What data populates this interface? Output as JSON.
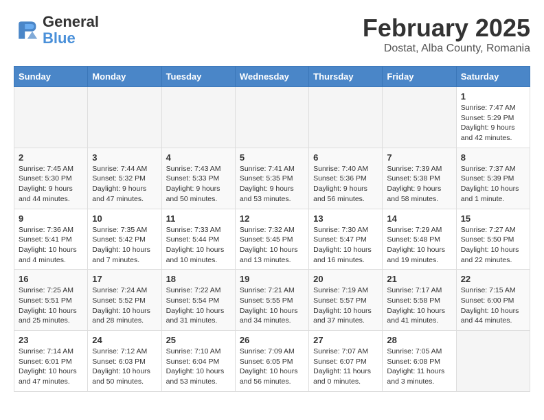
{
  "logo": {
    "text_general": "General",
    "text_blue": "Blue"
  },
  "title": "February 2025",
  "subtitle": "Dostat, Alba County, Romania",
  "weekdays": [
    "Sunday",
    "Monday",
    "Tuesday",
    "Wednesday",
    "Thursday",
    "Friday",
    "Saturday"
  ],
  "weeks": [
    [
      {
        "day": "",
        "info": ""
      },
      {
        "day": "",
        "info": ""
      },
      {
        "day": "",
        "info": ""
      },
      {
        "day": "",
        "info": ""
      },
      {
        "day": "",
        "info": ""
      },
      {
        "day": "",
        "info": ""
      },
      {
        "day": "1",
        "info": "Sunrise: 7:47 AM\nSunset: 5:29 PM\nDaylight: 9 hours and 42 minutes."
      }
    ],
    [
      {
        "day": "2",
        "info": "Sunrise: 7:45 AM\nSunset: 5:30 PM\nDaylight: 9 hours and 44 minutes."
      },
      {
        "day": "3",
        "info": "Sunrise: 7:44 AM\nSunset: 5:32 PM\nDaylight: 9 hours and 47 minutes."
      },
      {
        "day": "4",
        "info": "Sunrise: 7:43 AM\nSunset: 5:33 PM\nDaylight: 9 hours and 50 minutes."
      },
      {
        "day": "5",
        "info": "Sunrise: 7:41 AM\nSunset: 5:35 PM\nDaylight: 9 hours and 53 minutes."
      },
      {
        "day": "6",
        "info": "Sunrise: 7:40 AM\nSunset: 5:36 PM\nDaylight: 9 hours and 56 minutes."
      },
      {
        "day": "7",
        "info": "Sunrise: 7:39 AM\nSunset: 5:38 PM\nDaylight: 9 hours and 58 minutes."
      },
      {
        "day": "8",
        "info": "Sunrise: 7:37 AM\nSunset: 5:39 PM\nDaylight: 10 hours and 1 minute."
      }
    ],
    [
      {
        "day": "9",
        "info": "Sunrise: 7:36 AM\nSunset: 5:41 PM\nDaylight: 10 hours and 4 minutes."
      },
      {
        "day": "10",
        "info": "Sunrise: 7:35 AM\nSunset: 5:42 PM\nDaylight: 10 hours and 7 minutes."
      },
      {
        "day": "11",
        "info": "Sunrise: 7:33 AM\nSunset: 5:44 PM\nDaylight: 10 hours and 10 minutes."
      },
      {
        "day": "12",
        "info": "Sunrise: 7:32 AM\nSunset: 5:45 PM\nDaylight: 10 hours and 13 minutes."
      },
      {
        "day": "13",
        "info": "Sunrise: 7:30 AM\nSunset: 5:47 PM\nDaylight: 10 hours and 16 minutes."
      },
      {
        "day": "14",
        "info": "Sunrise: 7:29 AM\nSunset: 5:48 PM\nDaylight: 10 hours and 19 minutes."
      },
      {
        "day": "15",
        "info": "Sunrise: 7:27 AM\nSunset: 5:50 PM\nDaylight: 10 hours and 22 minutes."
      }
    ],
    [
      {
        "day": "16",
        "info": "Sunrise: 7:25 AM\nSunset: 5:51 PM\nDaylight: 10 hours and 25 minutes."
      },
      {
        "day": "17",
        "info": "Sunrise: 7:24 AM\nSunset: 5:52 PM\nDaylight: 10 hours and 28 minutes."
      },
      {
        "day": "18",
        "info": "Sunrise: 7:22 AM\nSunset: 5:54 PM\nDaylight: 10 hours and 31 minutes."
      },
      {
        "day": "19",
        "info": "Sunrise: 7:21 AM\nSunset: 5:55 PM\nDaylight: 10 hours and 34 minutes."
      },
      {
        "day": "20",
        "info": "Sunrise: 7:19 AM\nSunset: 5:57 PM\nDaylight: 10 hours and 37 minutes."
      },
      {
        "day": "21",
        "info": "Sunrise: 7:17 AM\nSunset: 5:58 PM\nDaylight: 10 hours and 41 minutes."
      },
      {
        "day": "22",
        "info": "Sunrise: 7:15 AM\nSunset: 6:00 PM\nDaylight: 10 hours and 44 minutes."
      }
    ],
    [
      {
        "day": "23",
        "info": "Sunrise: 7:14 AM\nSunset: 6:01 PM\nDaylight: 10 hours and 47 minutes."
      },
      {
        "day": "24",
        "info": "Sunrise: 7:12 AM\nSunset: 6:03 PM\nDaylight: 10 hours and 50 minutes."
      },
      {
        "day": "25",
        "info": "Sunrise: 7:10 AM\nSunset: 6:04 PM\nDaylight: 10 hours and 53 minutes."
      },
      {
        "day": "26",
        "info": "Sunrise: 7:09 AM\nSunset: 6:05 PM\nDaylight: 10 hours and 56 minutes."
      },
      {
        "day": "27",
        "info": "Sunrise: 7:07 AM\nSunset: 6:07 PM\nDaylight: 11 hours and 0 minutes."
      },
      {
        "day": "28",
        "info": "Sunrise: 7:05 AM\nSunset: 6:08 PM\nDaylight: 11 hours and 3 minutes."
      },
      {
        "day": "",
        "info": ""
      }
    ]
  ]
}
